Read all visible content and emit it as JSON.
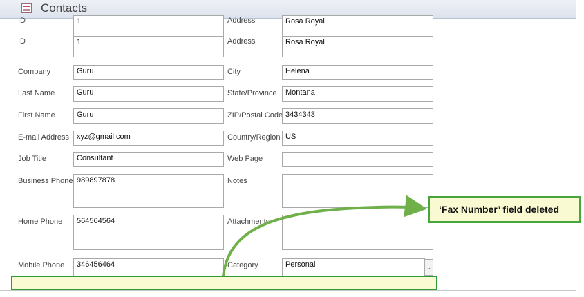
{
  "window": {
    "title": "Contacts",
    "icon": "form-icon"
  },
  "fields": {
    "id_label": "ID",
    "id_value": "1",
    "address_label": "Address",
    "address_value": "Rosa Royal",
    "company_label": "Company",
    "company_value": "Guru",
    "city_label": "City",
    "city_value": "Helena",
    "last_name_label": "Last Name",
    "last_name_value": "Guru",
    "state_label": "State/Province",
    "state_value": "Montana",
    "first_name_label": "First Name",
    "first_name_value": "Guru",
    "zip_label": "ZIP/Postal Code",
    "zip_value": "3434343",
    "email_label": "E-mail Address",
    "email_value": "xyz@gmail.com",
    "country_label": "Country/Region",
    "country_value": "US",
    "job_title_label": "Job Title",
    "job_title_value": "Consultant",
    "web_page_label": "Web Page",
    "web_page_value": "",
    "business_phone_label": "Business Phone",
    "business_phone_value": "989897878",
    "notes_label": "Notes",
    "notes_value": "",
    "home_phone_label": "Home Phone",
    "home_phone_value": "564564564",
    "attachments_label": "Attachments",
    "mobile_phone_label": "Mobile Phone",
    "mobile_phone_value": "346456464",
    "category_label": "Category",
    "category_value": "Personal"
  },
  "annotation": {
    "text": "‘Fax Number’ field deleted",
    "color": "#46a63c"
  }
}
